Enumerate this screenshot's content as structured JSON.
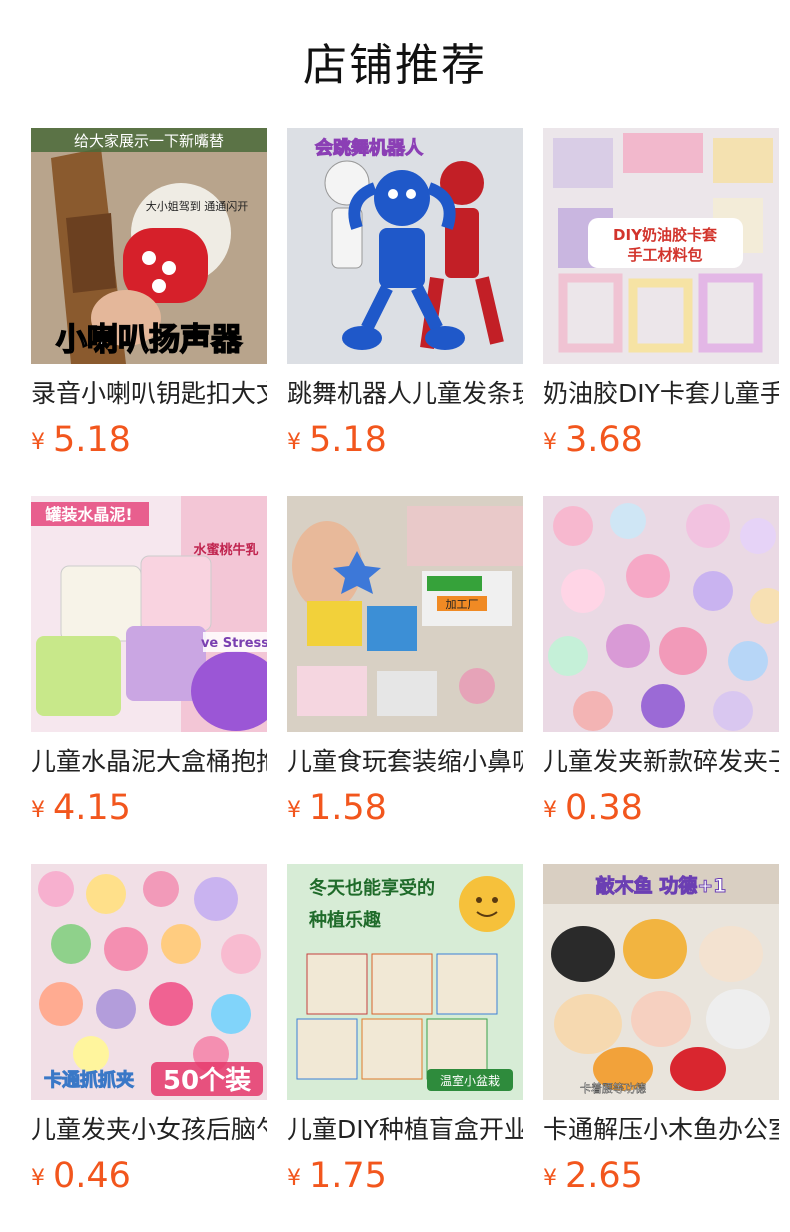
{
  "section": {
    "title": "店铺推荐"
  },
  "products": [
    {
      "name": "录音小喇叭钥匙扣大文件",
      "currency": "¥",
      "price": "5.18",
      "image_texts": [
        "给大家展示一下新嘴替",
        "小喇叭扬声器",
        "大小姐驾到 通通闪开"
      ],
      "image_desc": "red speaker keychain"
    },
    {
      "name": "跳舞机器人儿童发条玩具",
      "currency": "¥",
      "price": "5.18",
      "image_texts": [
        "会跳舞机器人"
      ],
      "image_desc": "dancing robot toys"
    },
    {
      "name": "奶油胶DIY卡套儿童手工",
      "currency": "¥",
      "price": "3.68",
      "image_texts": [
        "DIY奶油胶卡套",
        "手工材料包"
      ],
      "image_desc": "cream glue card sleeves"
    },
    {
      "name": "儿童水晶泥大盒桶抱抱",
      "currency": "¥",
      "price": "4.15",
      "image_texts": [
        "罐装水晶泥!",
        "水蜜桃牛乳",
        "ve Stress"
      ],
      "image_desc": "crystal slime tubs"
    },
    {
      "name": "儿童食玩套装缩小鼻吸",
      "currency": "¥",
      "price": "1.58",
      "image_texts": [
        "加工厂"
      ],
      "image_desc": "miniature food toys"
    },
    {
      "name": "儿童发夹新款碎发夹子",
      "currency": "¥",
      "price": "0.38",
      "image_texts": [],
      "image_desc": "cartoon hair clips"
    },
    {
      "name": "儿童发夹小女孩后脑勺",
      "currency": "¥",
      "price": "0.46",
      "image_texts": [
        "卡通抓抓夹",
        "50个装"
      ],
      "image_desc": "hair claw clips"
    },
    {
      "name": "儿童DIY种植盲盒开业",
      "currency": "¥",
      "price": "1.75",
      "image_texts": [
        "冬天也能享受的",
        "种植乐趣",
        "温室小盆栽"
      ],
      "image_desc": "planting blind boxes"
    },
    {
      "name": "卡通解压小木鱼办公室",
      "currency": "¥",
      "price": "2.65",
      "image_texts": [
        "敲木鱼 功德+1",
        "卡着腰等功德"
      ],
      "image_desc": "cat wooden fish toys"
    }
  ],
  "colors": {
    "price": "#f2561d",
    "title": "#111111",
    "name": "#222222"
  }
}
